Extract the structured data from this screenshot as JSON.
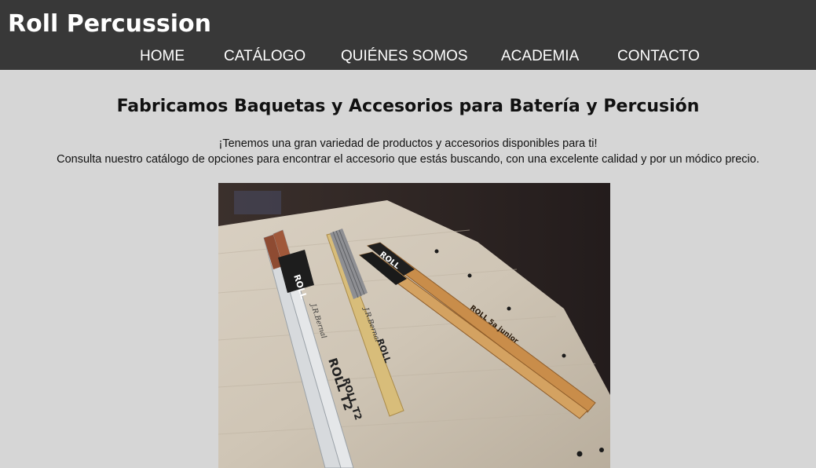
{
  "header": {
    "brand": "Roll Percussion",
    "nav": [
      {
        "label": "HOME"
      },
      {
        "label": "CATÁLOGO"
      },
      {
        "label": "QUIÉNES SOMOS"
      },
      {
        "label": "ACADEMIA"
      },
      {
        "label": "CONTACTO"
      }
    ]
  },
  "main": {
    "title": "Fabricamos Baquetas y Accesorios para Batería y Percusión",
    "intro_line1": "¡Tenemos una gran variedad de productos y accesorios disponibles para ti!",
    "intro_line2": "Consulta nuestro catálogo de opciones para encontrar el accesorio que estás buscando, con una excelente calidad y por un módico precio.",
    "hero_image": {
      "stick_labels": {
        "roll": "ROLL",
        "roll_t2": "ROLL T2",
        "roll_junior": "ROLL 5a junior",
        "signature": "J.R.Bernal"
      }
    }
  },
  "colors": {
    "header_bg": "#383838",
    "page_bg": "#d6d6d6",
    "nav_text": "#ffffff"
  }
}
